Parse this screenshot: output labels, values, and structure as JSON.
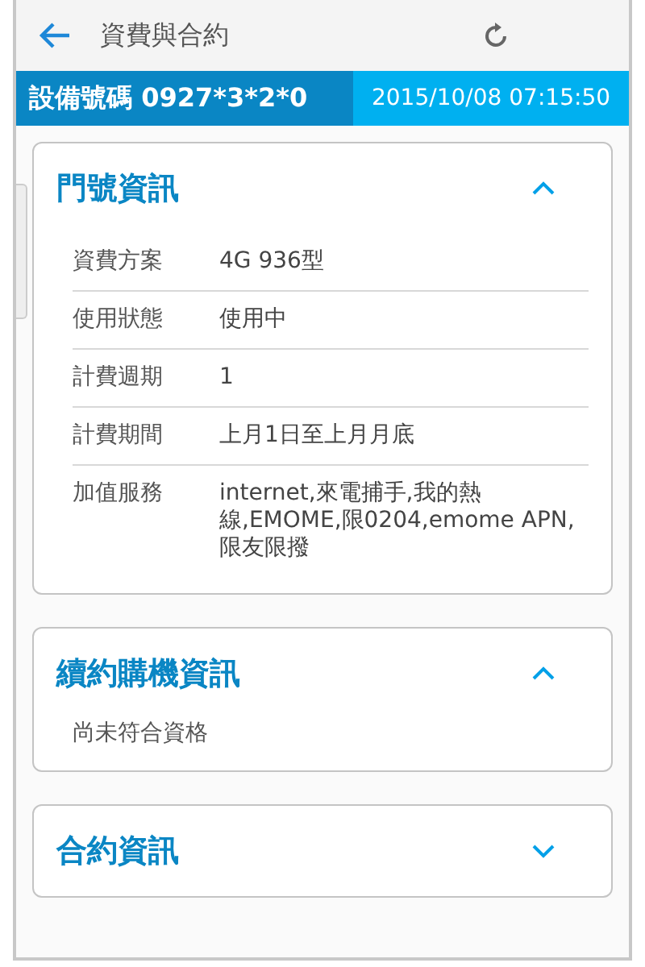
{
  "app_bar": {
    "title": "資費與合約"
  },
  "device_bar": {
    "number": "設備號碼 0927*3*2*0",
    "timestamp": "2015/10/08 07:15:50"
  },
  "sections": [
    {
      "kind": "table",
      "title": "門號資訊",
      "expanded": true,
      "rows": [
        {
          "label": "資費方案",
          "value": "4G 936型"
        },
        {
          "label": "使用狀態",
          "value": "使用中"
        },
        {
          "label": "計費週期",
          "value": "1"
        },
        {
          "label": "計費期間",
          "value": "上月1日至上月月底"
        },
        {
          "label": "加值服務",
          "value": "internet,來電捕手,我的熱線,EMOME,限0204,emome APN,限友限撥"
        }
      ]
    },
    {
      "kind": "note",
      "title": "續約購機資訊",
      "expanded": true,
      "text": "尚未符合資格"
    },
    {
      "title": "合約資訊",
      "expanded": false
    }
  ]
}
